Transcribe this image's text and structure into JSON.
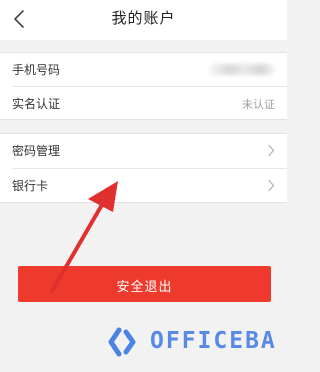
{
  "header": {
    "title": "我的账户"
  },
  "account_info": {
    "rows": [
      {
        "label": "手机号码",
        "value": ""
      },
      {
        "label": "实名认证",
        "value": "未认证"
      }
    ]
  },
  "settings": {
    "rows": [
      {
        "label": "密码管理"
      },
      {
        "label": "银行卡"
      }
    ]
  },
  "logout": {
    "label": "安全退出",
    "color": "#ee3a2c"
  },
  "overlay": {
    "arrow_color": "#e02f2f",
    "watermark_text": "OFFICEBA",
    "watermark_color": "#4a82e6"
  },
  "icons": {
    "back": "chevron-left-icon",
    "row_arrow": "chevron-right-icon"
  }
}
